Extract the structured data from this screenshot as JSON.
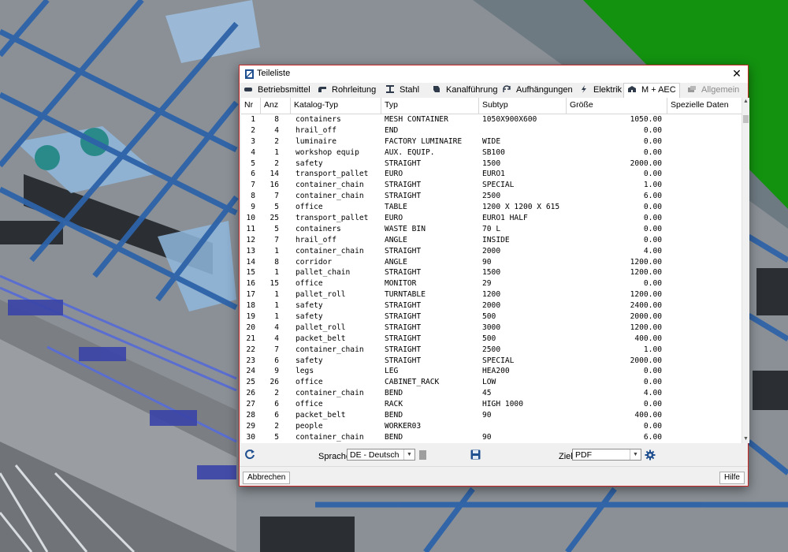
{
  "window": {
    "title": "Teileliste",
    "close_glyph": "✕"
  },
  "tabs": [
    {
      "label": "Betriebsmittel",
      "icon": "equipment-icon",
      "state": "normal"
    },
    {
      "label": "Rohrleitung",
      "icon": "pipe-icon",
      "state": "normal"
    },
    {
      "label": "Stahl",
      "icon": "steel-beam-icon",
      "state": "normal"
    },
    {
      "label": "Kanalführung",
      "icon": "duct-icon",
      "state": "normal"
    },
    {
      "label": "Aufhängungen",
      "icon": "hanger-icon",
      "state": "normal"
    },
    {
      "label": "Elektrik",
      "icon": "lightning-icon",
      "state": "normal"
    },
    {
      "label": "M + AEC",
      "icon": "building-icon",
      "state": "active"
    },
    {
      "label": "Allgemein",
      "icon": "general-icon",
      "state": "disabled"
    }
  ],
  "table": {
    "columns": [
      "Nr",
      "Anz",
      "Katalog-Typ",
      "Typ",
      "Subtyp",
      "Größe",
      "Spezielle Daten"
    ],
    "rows": [
      [
        "1",
        "8",
        "containers",
        "MESH CONTAINER",
        "1050X900X600",
        "1050.00"
      ],
      [
        "2",
        "4",
        "hrail_off",
        "END",
        "",
        "0.00"
      ],
      [
        "3",
        "2",
        "luminaire",
        "FACTORY LUMINAIRE",
        "WIDE",
        "0.00"
      ],
      [
        "4",
        "1",
        "workshop equip",
        "AUX. EQUIP.",
        "SB100",
        "0.00"
      ],
      [
        "5",
        "2",
        "safety",
        "STRAIGHT",
        "1500",
        "2000.00"
      ],
      [
        "6",
        "14",
        "transport_pallet",
        "EURO",
        "EURO1",
        "0.00"
      ],
      [
        "7",
        "16",
        "container_chain",
        "STRAIGHT",
        "SPECIAL",
        "1.00"
      ],
      [
        "8",
        "7",
        "container_chain",
        "STRAIGHT",
        "2500",
        "6.00"
      ],
      [
        "9",
        "5",
        "office",
        "TABLE",
        "1200 X 1200 X 615",
        "0.00"
      ],
      [
        "10",
        "25",
        "transport_pallet",
        "EURO",
        "EURO1 HALF",
        "0.00"
      ],
      [
        "11",
        "5",
        "containers",
        "WASTE BIN",
        "70 L",
        "0.00"
      ],
      [
        "12",
        "7",
        "hrail_off",
        "ANGLE",
        "INSIDE",
        "0.00"
      ],
      [
        "13",
        "1",
        "container_chain",
        "STRAIGHT",
        "2000",
        "4.00"
      ],
      [
        "14",
        "8",
        "corridor",
        "ANGLE",
        "90",
        "1200.00"
      ],
      [
        "15",
        "1",
        "pallet_chain",
        "STRAIGHT",
        "1500",
        "1200.00"
      ],
      [
        "16",
        "15",
        "office",
        "MONITOR",
        "29",
        "0.00"
      ],
      [
        "17",
        "1",
        "pallet_roll",
        "TURNTABLE",
        "1200",
        "1200.00"
      ],
      [
        "18",
        "1",
        "safety",
        "STRAIGHT",
        "2000",
        "2400.00"
      ],
      [
        "19",
        "1",
        "safety",
        "STRAIGHT",
        "500",
        "2000.00"
      ],
      [
        "20",
        "4",
        "pallet_roll",
        "STRAIGHT",
        "3000",
        "1200.00"
      ],
      [
        "21",
        "4",
        "packet_belt",
        "STRAIGHT",
        "500",
        "400.00"
      ],
      [
        "22",
        "7",
        "container_chain",
        "STRAIGHT",
        "2500",
        "1.00"
      ],
      [
        "23",
        "6",
        "safety",
        "STRAIGHT",
        "SPECIAL",
        "2000.00"
      ],
      [
        "24",
        "9",
        "legs",
        "LEG",
        "HEA200",
        "0.00"
      ],
      [
        "25",
        "26",
        "office",
        "CABINET_RACK",
        "LOW",
        "0.00"
      ],
      [
        "26",
        "2",
        "container_chain",
        "BEND",
        "45",
        "4.00"
      ],
      [
        "27",
        "6",
        "office",
        "RACK",
        "HIGH 1000",
        "0.00"
      ],
      [
        "28",
        "6",
        "packet_belt",
        "BEND",
        "90",
        "400.00"
      ],
      [
        "29",
        "2",
        "people",
        "WORKER03",
        "",
        "0.00"
      ],
      [
        "30",
        "5",
        "container_chain",
        "BEND",
        "90",
        "6.00"
      ]
    ]
  },
  "controls": {
    "language_label": "Sprache",
    "language_value": "DE - Deutsch",
    "target_label": "Ziel",
    "target_value": "PDF"
  },
  "buttons": {
    "cancel": "Abbrechen",
    "help": "Hilfe"
  },
  "colors": {
    "accent_border": "#c62828",
    "icon_blue": "#1f4f8f"
  }
}
